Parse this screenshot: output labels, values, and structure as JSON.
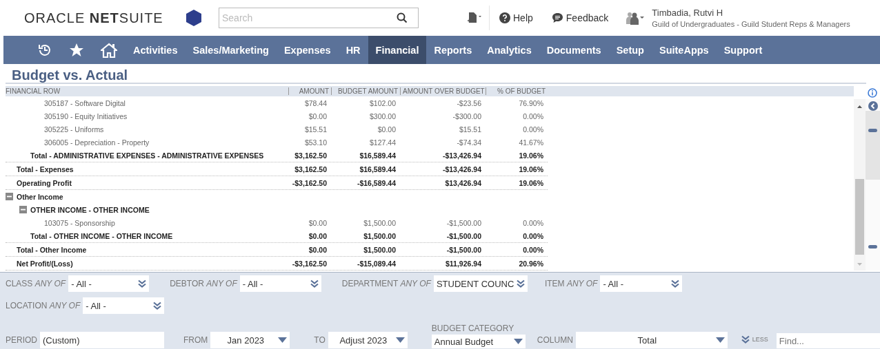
{
  "header": {
    "logo": "ORACLE **NET**SUITE",
    "search": {
      "placeholder": "Search"
    },
    "help": "Help",
    "feedback": "Feedback",
    "user": {
      "name": "Timbadia, Rutvi H",
      "role": "Guild of Undergraduates - Guild Student Reps & Managers"
    }
  },
  "nav": {
    "items": [
      {
        "label": "Activities",
        "selected": false
      },
      {
        "label": "Sales/Marketing",
        "selected": false
      },
      {
        "label": "Expenses",
        "selected": false
      },
      {
        "label": "HR",
        "selected": false
      },
      {
        "label": "Financial",
        "selected": true
      },
      {
        "label": "Reports",
        "selected": false
      },
      {
        "label": "Analytics",
        "selected": false
      },
      {
        "label": "Documents",
        "selected": false
      },
      {
        "label": "Setup",
        "selected": false
      },
      {
        "label": "SuiteApps",
        "selected": false
      },
      {
        "label": "Support",
        "selected": false
      }
    ]
  },
  "page_title": "Budget vs. Actual",
  "report": {
    "columns": [
      "FINANCIAL ROW",
      "AMOUNT",
      "BUDGET AMOUNT",
      "AMOUNT OVER BUDGET",
      "% OF BUDGET"
    ],
    "rows": [
      {
        "kind": "group",
        "children": [
          {
            "kind": "group",
            "children": [
              {
                "kind": "detail",
                "label": "305187 - Software Digital",
                "values": [
                  "$78.44",
                  "$102.00",
                  "-$23.56",
                  "76.90%"
                ]
              },
              {
                "kind": "detail",
                "label": "305190 - Equity Initiatives",
                "values": [
                  "$0.00",
                  "$300.00",
                  "-$300.00",
                  "0.00%"
                ]
              },
              {
                "kind": "detail",
                "label": "305225 - Uniforms",
                "values": [
                  "$15.51",
                  "$0.00",
                  "$15.51",
                  "0.00%"
                ]
              },
              {
                "kind": "detail",
                "label": "306005 - Depreciation - Property",
                "values": [
                  "$53.10",
                  "$127.44",
                  "-$74.34",
                  "41.67%"
                ]
              }
            ]
          },
          {
            "kind": "total",
            "label": "Total - ADMINISTRATIVE EXPENSES - ADMINISTRATIVE EXPENSES",
            "values": [
              "$3,162.50",
              "$16,589.44",
              "-$13,426.94",
              "19.06%"
            ]
          }
        ]
      },
      {
        "kind": "total",
        "label": "Total - Expenses",
        "values": [
          "$3,162.50",
          "$16,589.44",
          "-$13,426.94",
          "19.06%"
        ]
      },
      {
        "kind": "total",
        "label": "Operating Profit",
        "values": [
          "-$3,162.50",
          "-$16,589.44",
          "$13,426.94",
          "19.06%"
        ]
      },
      {
        "kind": "section",
        "label": "Other Income",
        "expanded": true,
        "children": [
          {
            "kind": "section",
            "label": "OTHER INCOME - OTHER INCOME",
            "expanded": true,
            "children": [
              {
                "kind": "detail",
                "label": "103075 - Sponsorship",
                "values": [
                  "$0.00",
                  "$1,500.00",
                  "-$1,500.00",
                  "0.00%"
                ]
              }
            ]
          },
          {
            "kind": "total",
            "label": "Total - OTHER INCOME - OTHER INCOME",
            "values": [
              "$0.00",
              "$1,500.00",
              "-$1,500.00",
              "0.00%"
            ]
          }
        ]
      },
      {
        "kind": "total",
        "label": "Total - Other Income",
        "values": [
          "$0.00",
          "$1,500.00",
          "-$1,500.00",
          "0.00%"
        ]
      },
      {
        "kind": "total",
        "label": "Net Profit/(Loss)",
        "values": [
          "-$3,162.50",
          "-$15,089.44",
          "$11,926.94",
          "20.96%"
        ]
      }
    ]
  },
  "filter_rows": [
    [
      {
        "kind": "multiselect",
        "label": "CLASS *ANY OF*",
        "value": "- All -"
      },
      {
        "kind": "multiselect",
        "label": "DEBTOR *ANY OF*",
        "value": "- All -"
      },
      {
        "kind": "multiselect",
        "label": "DEPARTMENT *ANY OF*",
        "value": "STUDENT COUNC"
      },
      {
        "kind": "multiselect",
        "label": "ITEM *ANY OF*",
        "value": "- All -"
      }
    ],
    [
      {
        "kind": "multiselect",
        "label": "LOCATION *ANY OF*",
        "value": "- All -"
      }
    ],
    [
      {
        "kind": "text",
        "label": "PERIOD",
        "value": "(Custom)"
      },
      {
        "kind": "select",
        "label": "FROM",
        "value": "Jan 2023"
      },
      {
        "kind": "select",
        "label": "TO",
        "value": "Adjust 2023"
      },
      {
        "kind": "stacked_select",
        "label": "BUDGET CATEGORY",
        "value": "Annual Budget"
      },
      {
        "kind": "select",
        "label": "COLUMN",
        "value": "Total"
      },
      {
        "kind": "toggle",
        "label": "LESS"
      },
      {
        "kind": "search",
        "placeholder": "Find..."
      }
    ]
  ]
}
